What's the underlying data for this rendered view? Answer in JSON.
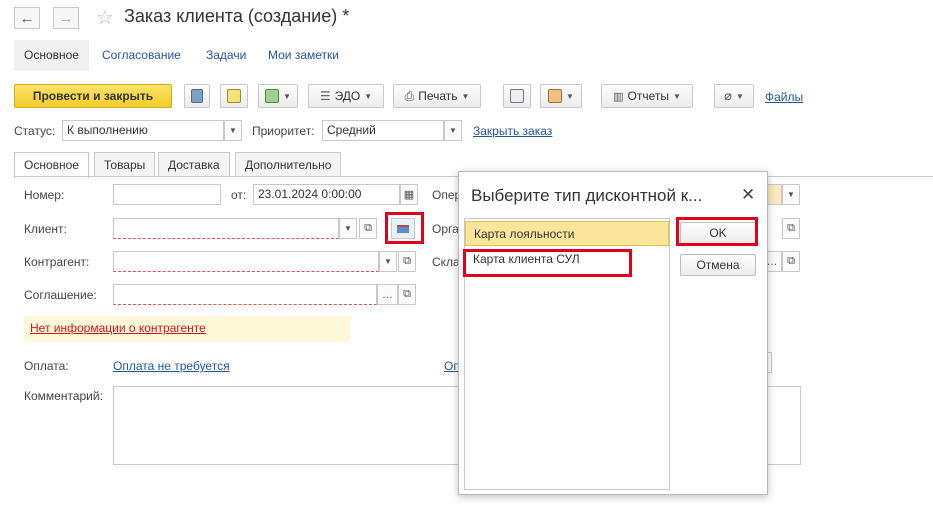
{
  "window": {
    "title": "Заказ клиента (создание) *"
  },
  "top_tabs": [
    {
      "label": "Основное"
    },
    {
      "label": "Согласование"
    },
    {
      "label": "Задачи"
    },
    {
      "label": "Мои заметки"
    }
  ],
  "toolbar": {
    "post_close_label": "Провести и закрыть",
    "edo_label": "ЭДО",
    "print_label": "Печать",
    "reports_label": "Отчеты",
    "files_label": "Файлы"
  },
  "status_row": {
    "status_label": "Статус:",
    "status_value": "К выполнению",
    "priority_label": "Приоритет:",
    "priority_value": "Средний",
    "close_order_link": "Закрыть заказ"
  },
  "inner_tabs": [
    {
      "label": "Основное"
    },
    {
      "label": "Товары"
    },
    {
      "label": "Доставка"
    },
    {
      "label": "Дополнительно"
    }
  ],
  "form": {
    "number_label": "Номер:",
    "number_value": "",
    "from_label": "от:",
    "date_value": "23.01.2024  0:00:00",
    "operation_label": "Опер",
    "client_label": "Клиент:",
    "client_value": "",
    "org_label": "Орга",
    "contractor_label": "Контрагент:",
    "contractor_value": "",
    "warehouse_label": "Скла",
    "agreement_label": "Соглашение:",
    "agreement_value": "",
    "no_info_link": "Нет информации о контрагенте",
    "payment_label": "Оплата:",
    "payment_link": "Оплата не требуется",
    "payment_link2": "Оп",
    "comment_label": "Комментарий:",
    "comment_value": ""
  },
  "dialog": {
    "title": "Выберите тип дисконтной к...",
    "items": [
      {
        "label": "Карта лояльности",
        "selected": true
      },
      {
        "label": "Карта клиента СУЛ",
        "selected": false
      }
    ],
    "ok_label": "OK",
    "cancel_label": "Отмена"
  },
  "colors": {
    "highlight_red": "#e0001b",
    "link_blue": "#2255a4",
    "primary_yellow": "#f3cc2a",
    "selection_yellow": "#fbe59b",
    "warning_bg": "#fef7d8"
  }
}
